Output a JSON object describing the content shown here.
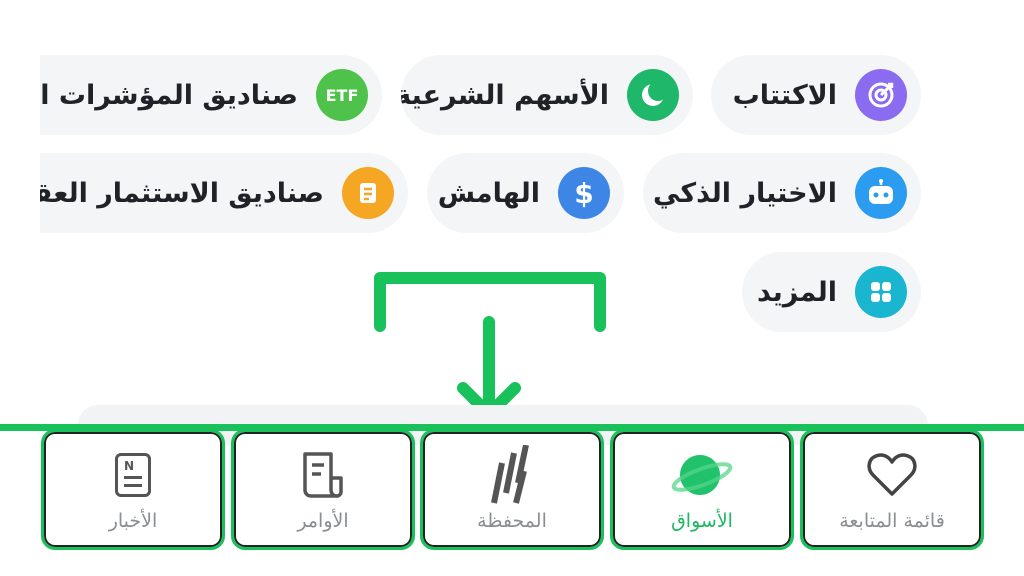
{
  "chips": {
    "ipo": {
      "label": "الاكتتاب",
      "icon": "target-icon",
      "color": "#8b6cf0"
    },
    "sharia": {
      "label": "الأسهم الشرعية",
      "icon": "crescent-icon",
      "color": "#1fb86a"
    },
    "etf": {
      "label": "صناديق المؤشرات المت",
      "icon": "etf-icon",
      "icon_text": "ETF",
      "color": "#4ec24a"
    },
    "smart": {
      "label": "الاختيار الذكي",
      "icon": "robot-icon",
      "color": "#2c9cf0"
    },
    "margin": {
      "label": "الهامش",
      "icon": "dollar-icon",
      "icon_text": "$",
      "color": "#3d86e6"
    },
    "reit": {
      "label": "صناديق الاستثمار العقاري",
      "icon": "document-icon",
      "color": "#f5a623"
    },
    "more": {
      "label": "المزيد",
      "icon": "grid-icon",
      "color": "#1ab5cf"
    }
  },
  "nav": {
    "watchlist": {
      "label": "قائمة المتابعة",
      "icon": "heart-icon"
    },
    "markets": {
      "label": "الأسواق",
      "icon": "planet-icon",
      "active": true
    },
    "portfolio": {
      "label": "المحفظة",
      "icon": "bars-icon"
    },
    "orders": {
      "label": "الأوامر",
      "icon": "receipt-icon"
    },
    "news": {
      "label": "الأخبار",
      "icon": "newspaper-icon",
      "icon_text": "N"
    }
  },
  "colors": {
    "highlight": "#19c15a",
    "active_tab": "#1fb862"
  }
}
